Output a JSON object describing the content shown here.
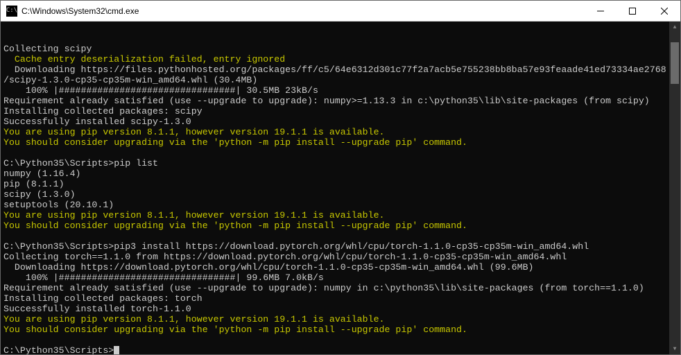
{
  "titlebar": {
    "icon_text": "C:\\",
    "title": "C:\\Windows\\System32\\cmd.exe"
  },
  "lines": [
    {
      "cls": "white",
      "text": "Collecting scipy"
    },
    {
      "cls": "yellow",
      "text": "  Cache entry deserialization failed, entry ignored"
    },
    {
      "cls": "white",
      "text": "  Downloading https://files.pythonhosted.org/packages/ff/c5/64e6312d301c77f2a7acb5e755238bb8ba57e93feaade41ed73334ae2768"
    },
    {
      "cls": "white",
      "text": "/scipy-1.3.0-cp35-cp35m-win_amd64.whl (30.4MB)"
    },
    {
      "cls": "white",
      "text": "    100% |################################| 30.5MB 23kB/s"
    },
    {
      "cls": "white",
      "text": "Requirement already satisfied (use --upgrade to upgrade): numpy>=1.13.3 in c:\\python35\\lib\\site-packages (from scipy)"
    },
    {
      "cls": "white",
      "text": "Installing collected packages: scipy"
    },
    {
      "cls": "white",
      "text": "Successfully installed scipy-1.3.0"
    },
    {
      "cls": "yellow",
      "text": "You are using pip version 8.1.1, however version 19.1.1 is available."
    },
    {
      "cls": "yellow",
      "text": "You should consider upgrading via the 'python -m pip install --upgrade pip' command."
    },
    {
      "cls": "white",
      "text": ""
    },
    {
      "cls": "white",
      "text": "C:\\Python35\\Scripts>pip list"
    },
    {
      "cls": "white",
      "text": "numpy (1.16.4)"
    },
    {
      "cls": "white",
      "text": "pip (8.1.1)"
    },
    {
      "cls": "white",
      "text": "scipy (1.3.0)"
    },
    {
      "cls": "white",
      "text": "setuptools (20.10.1)"
    },
    {
      "cls": "yellow",
      "text": "You are using pip version 8.1.1, however version 19.1.1 is available."
    },
    {
      "cls": "yellow",
      "text": "You should consider upgrading via the 'python -m pip install --upgrade pip' command."
    },
    {
      "cls": "white",
      "text": ""
    },
    {
      "cls": "white",
      "text": "C:\\Python35\\Scripts>pip3 install https://download.pytorch.org/whl/cpu/torch-1.1.0-cp35-cp35m-win_amd64.whl"
    },
    {
      "cls": "white",
      "text": "Collecting torch==1.1.0 from https://download.pytorch.org/whl/cpu/torch-1.1.0-cp35-cp35m-win_amd64.whl"
    },
    {
      "cls": "white",
      "text": "  Downloading https://download.pytorch.org/whl/cpu/torch-1.1.0-cp35-cp35m-win_amd64.whl (99.6MB)"
    },
    {
      "cls": "white",
      "text": "    100% |################################| 99.6MB 7.0kB/s"
    },
    {
      "cls": "white",
      "text": "Requirement already satisfied (use --upgrade to upgrade): numpy in c:\\python35\\lib\\site-packages (from torch==1.1.0)"
    },
    {
      "cls": "white",
      "text": "Installing collected packages: torch"
    },
    {
      "cls": "white",
      "text": "Successfully installed torch-1.1.0"
    },
    {
      "cls": "yellow",
      "text": "You are using pip version 8.1.1, however version 19.1.1 is available."
    },
    {
      "cls": "yellow",
      "text": "You should consider upgrading via the 'python -m pip install --upgrade pip' command."
    },
    {
      "cls": "white",
      "text": ""
    }
  ],
  "prompt": "C:\\Python35\\Scripts>"
}
